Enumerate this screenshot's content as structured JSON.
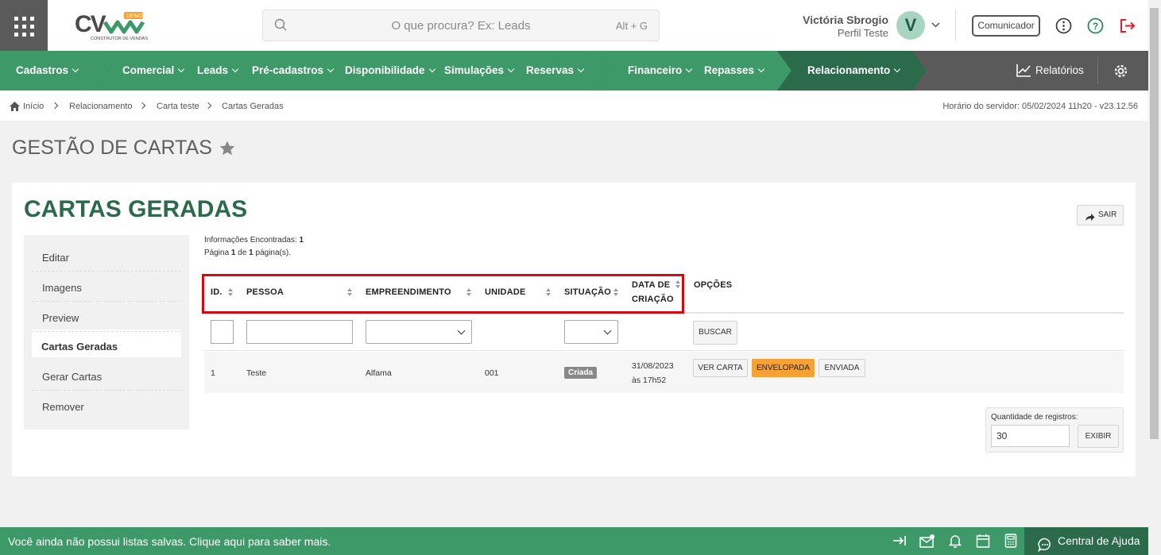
{
  "logo": {
    "text": "CV",
    "badge": "DEMO",
    "subtitle": "CONSTRUTOR DE VENDAS"
  },
  "search": {
    "placeholder": "O que procura? Ex: Leads",
    "shortcut": "Alt + G"
  },
  "user": {
    "name": "Victória Sbrogio",
    "profile": "Perfil Teste",
    "initial": "V"
  },
  "header": {
    "communicator_label": "Comunicador"
  },
  "nav": {
    "items": [
      "Cadastros",
      "Comercial",
      "Leads",
      "Pré-cadastros",
      "Disponibilidade",
      "Simulações",
      "Reservas",
      "Financeiro",
      "Repasses",
      "Relacionamento"
    ],
    "reports_label": "Relatórios"
  },
  "breadcrumb": {
    "items": [
      "Início",
      "Relacionamento",
      "Carta teste",
      "Cartas Geradas"
    ]
  },
  "server_time": "Horário do servidor: 05/02/2024 11h20 - v23.12.56",
  "page_title": "GESTÃO DE CARTAS",
  "card": {
    "title": "CARTAS GERADAS",
    "exit_label": "SAIR"
  },
  "sidebar": {
    "items": [
      "Editar",
      "Imagens",
      "Preview",
      "Cartas Geradas",
      "Gerar Cartas",
      "Remover"
    ],
    "active": "Cartas Geradas"
  },
  "info": {
    "found_label": "Informações Encontradas:",
    "found_count": "1",
    "page_prefix": "Página",
    "page_current": "1",
    "page_of": "de",
    "page_total": "1",
    "page_suffix": "página(s)."
  },
  "table": {
    "columns": [
      "ID.",
      "PESSOA",
      "EMPREENDIMENTO",
      "UNIDADE",
      "SITUAÇÃO",
      "DATA DE",
      "CRIAÇÃO",
      "OPÇÕES"
    ],
    "search_button": "BUSCAR",
    "rows": [
      {
        "id": "1",
        "pessoa": "Teste",
        "empreendimento": "Alfama",
        "unidade": "001",
        "situacao": "Criada",
        "data": "31/08/2023",
        "hora": "às 17h52",
        "actions": [
          "VER CARTA",
          "ENVELOPADA",
          "ENVIADA"
        ]
      }
    ]
  },
  "records": {
    "label": "Quantidade de registros:",
    "value": "30",
    "button": "EXIBIR"
  },
  "footer": {
    "message": "Você ainda não possui listas salvas. Clique aqui para saber mais.",
    "help_label": "Central de Ajuda"
  },
  "colors": {
    "green_dark": "#2b6a4a",
    "green": "#3d9968",
    "orange": "#f5a133",
    "red_highlight": "#d6080e",
    "gray_nav": "#5a5a5a"
  }
}
